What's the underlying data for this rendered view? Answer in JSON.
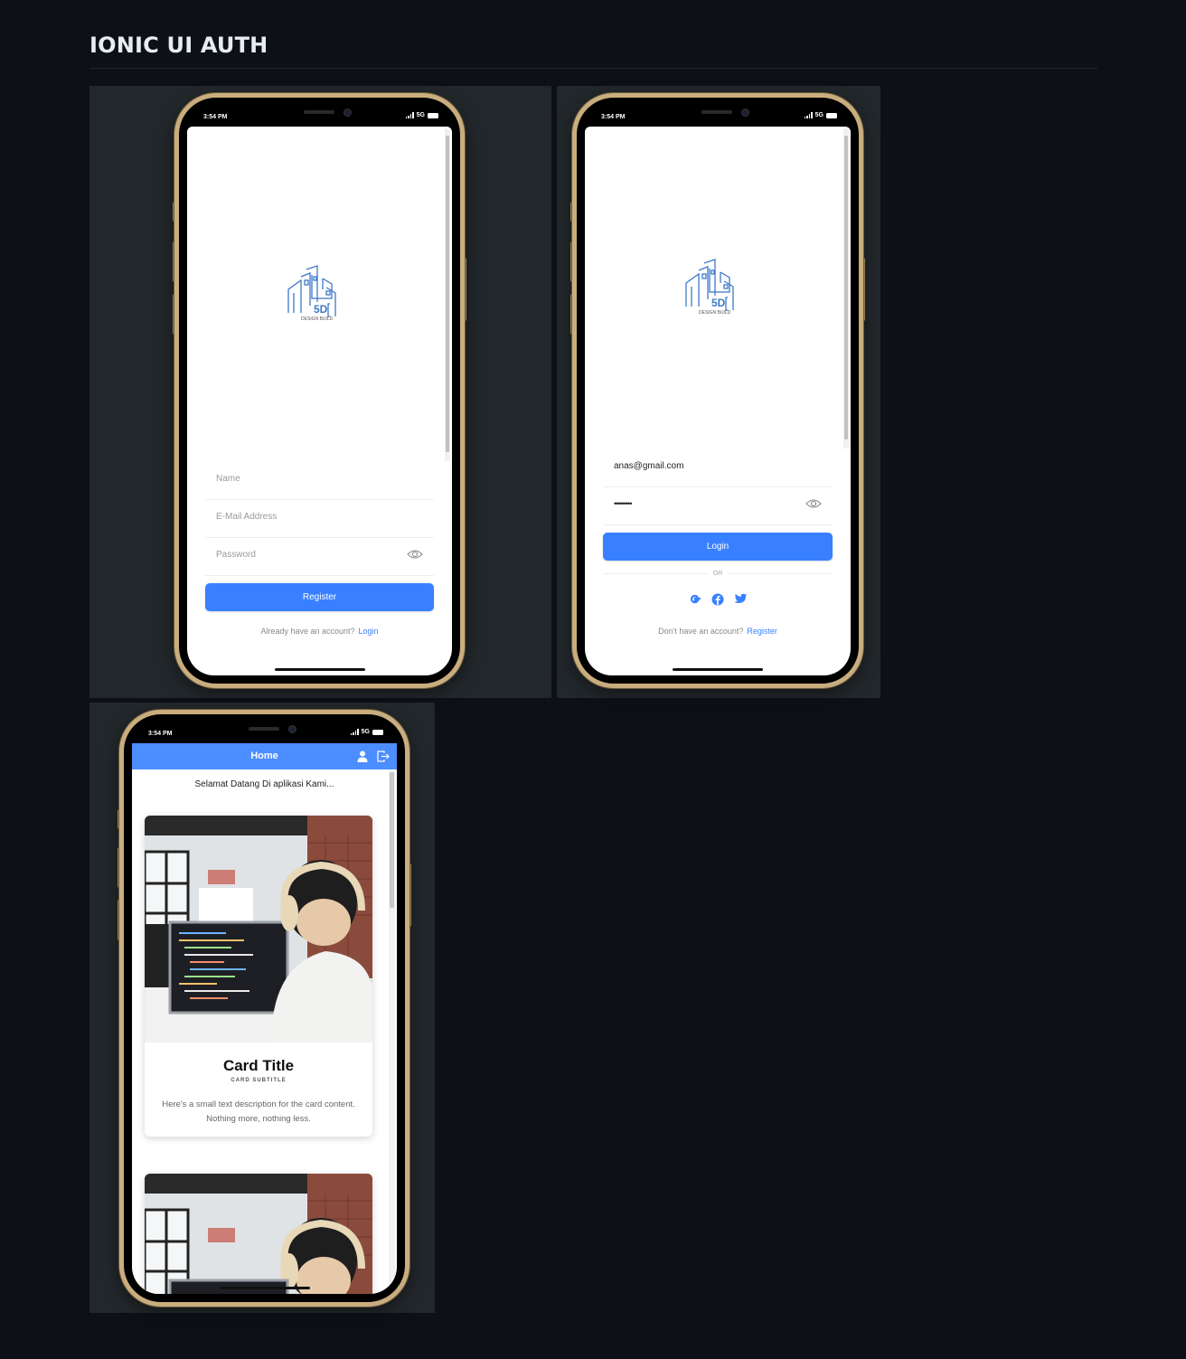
{
  "page": {
    "title": "IONIC UI AUTH"
  },
  "status_bar": {
    "time": "3:54 PM",
    "network": "5G"
  },
  "register_screen": {
    "name_placeholder": "Name",
    "email_placeholder": "E-Mail Address",
    "password_placeholder": "Password",
    "register_button": "Register",
    "footer_text": "Already have an account?",
    "footer_link": "Login"
  },
  "login_screen": {
    "email_value": "anas@gmail.com",
    "password_value": "•••••••••",
    "login_button": "Login",
    "or_text": "OR",
    "footer_text": "Don't have an account?",
    "footer_link": "Register"
  },
  "home_screen": {
    "header_title": "Home",
    "welcome_text": "Selamat Datang Di aplikasi Kami...",
    "cards": [
      {
        "title": "Card Title",
        "subtitle": "CARD SUBTITLE",
        "text": "Here's a small text description for the card content. Nothing more, nothing less."
      }
    ]
  },
  "logo": {
    "label": "5D",
    "caption": "DESIGN BUILD"
  },
  "colors": {
    "primary": "#3880ff",
    "header": "#4c8dff",
    "bezel": "#c9ad7e",
    "background": "#0d1117"
  }
}
